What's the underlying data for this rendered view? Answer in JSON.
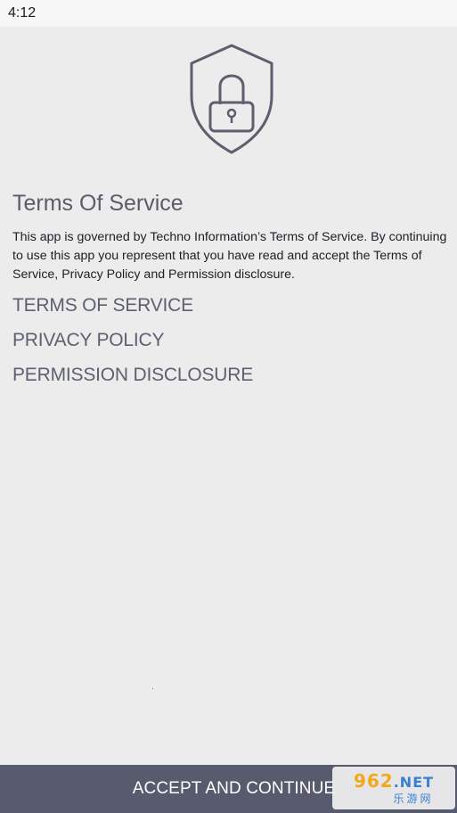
{
  "status_bar": {
    "time": "4:12"
  },
  "terms": {
    "title": "Terms Of Service",
    "description": "This app is governed by Techno Information’s Terms of Service. By continuing to use this app you represent that you have read and accept the Terms of Service, Privacy Policy and Permission disclosure.",
    "links": [
      {
        "label": "TERMS OF SERVICE"
      },
      {
        "label": "PRIVACY POLICY"
      },
      {
        "label": "PERMISSION DISCLOSURE"
      }
    ]
  },
  "footer": {
    "accept_label": "ACCEPT AND CONTINUE"
  },
  "watermark": {
    "top": "962",
    "suffix": ".NET",
    "bottom": "乐游网"
  },
  "colors": {
    "background": "#ececec",
    "link": "#5d6070",
    "accept_bar": "#585a6e",
    "icon_stroke": "#5d5f6e"
  },
  "icons": {
    "hero": "shield-lock-icon"
  }
}
